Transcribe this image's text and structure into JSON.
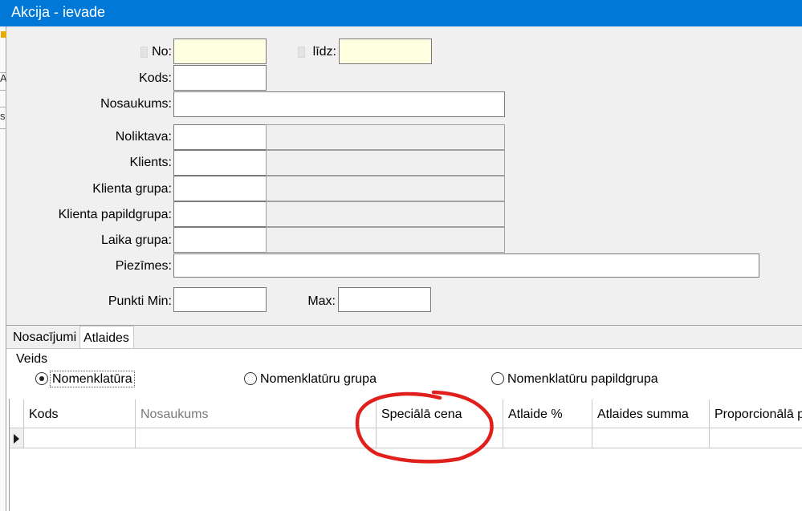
{
  "window": {
    "title": "Akcija - ievade"
  },
  "edge": {
    "glyphs": [
      "A",
      "s"
    ]
  },
  "form": {
    "no": {
      "label": "No:",
      "value": ""
    },
    "lidz": {
      "label": "līdz:",
      "value": ""
    },
    "kods": {
      "label": "Kods:",
      "value": ""
    },
    "nosaukums": {
      "label": "Nosaukums:",
      "value": ""
    },
    "noliktava": {
      "label": "Noliktava:",
      "code": "",
      "name": ""
    },
    "klients": {
      "label": "Klients:",
      "code": "",
      "name": ""
    },
    "klienta_grupa": {
      "label": "Klienta grupa:",
      "code": "",
      "name": ""
    },
    "klienta_papildgrupa": {
      "label": "Klienta papildgrupa:",
      "code": "",
      "name": ""
    },
    "laika_grupa": {
      "label": "Laika grupa:",
      "code": "",
      "name": ""
    },
    "piezimes": {
      "label": "Piezīmes:",
      "value": ""
    },
    "punkti_min": {
      "label": "Punkti Min:",
      "value": ""
    },
    "max": {
      "label": "Max:",
      "value": ""
    }
  },
  "tabs": [
    {
      "label": "Nosacījumi",
      "active": false
    },
    {
      "label": "Atlaides",
      "active": true
    }
  ],
  "veids": {
    "label": "Veids",
    "options": [
      {
        "label": "Nomenklatūra",
        "selected": true
      },
      {
        "label": "Nomenklatūru grupa",
        "selected": false
      },
      {
        "label": "Nomenklatūru papildgrupa",
        "selected": false
      }
    ]
  },
  "grid": {
    "columns": [
      "Kods",
      "Nosaukums",
      "Speciālā cena",
      "Atlaide %",
      "Atlaides summa",
      "Proporcionālā p"
    ],
    "rows": [
      [
        "",
        "",
        "",
        "",
        "",
        ""
      ]
    ]
  },
  "annotation": {
    "color": "#e0201c",
    "shape": "hand-drawn circle around Speciālā cena column header"
  },
  "colors": {
    "titlebar": "#0078d7",
    "required_field": "#ffffe1"
  }
}
